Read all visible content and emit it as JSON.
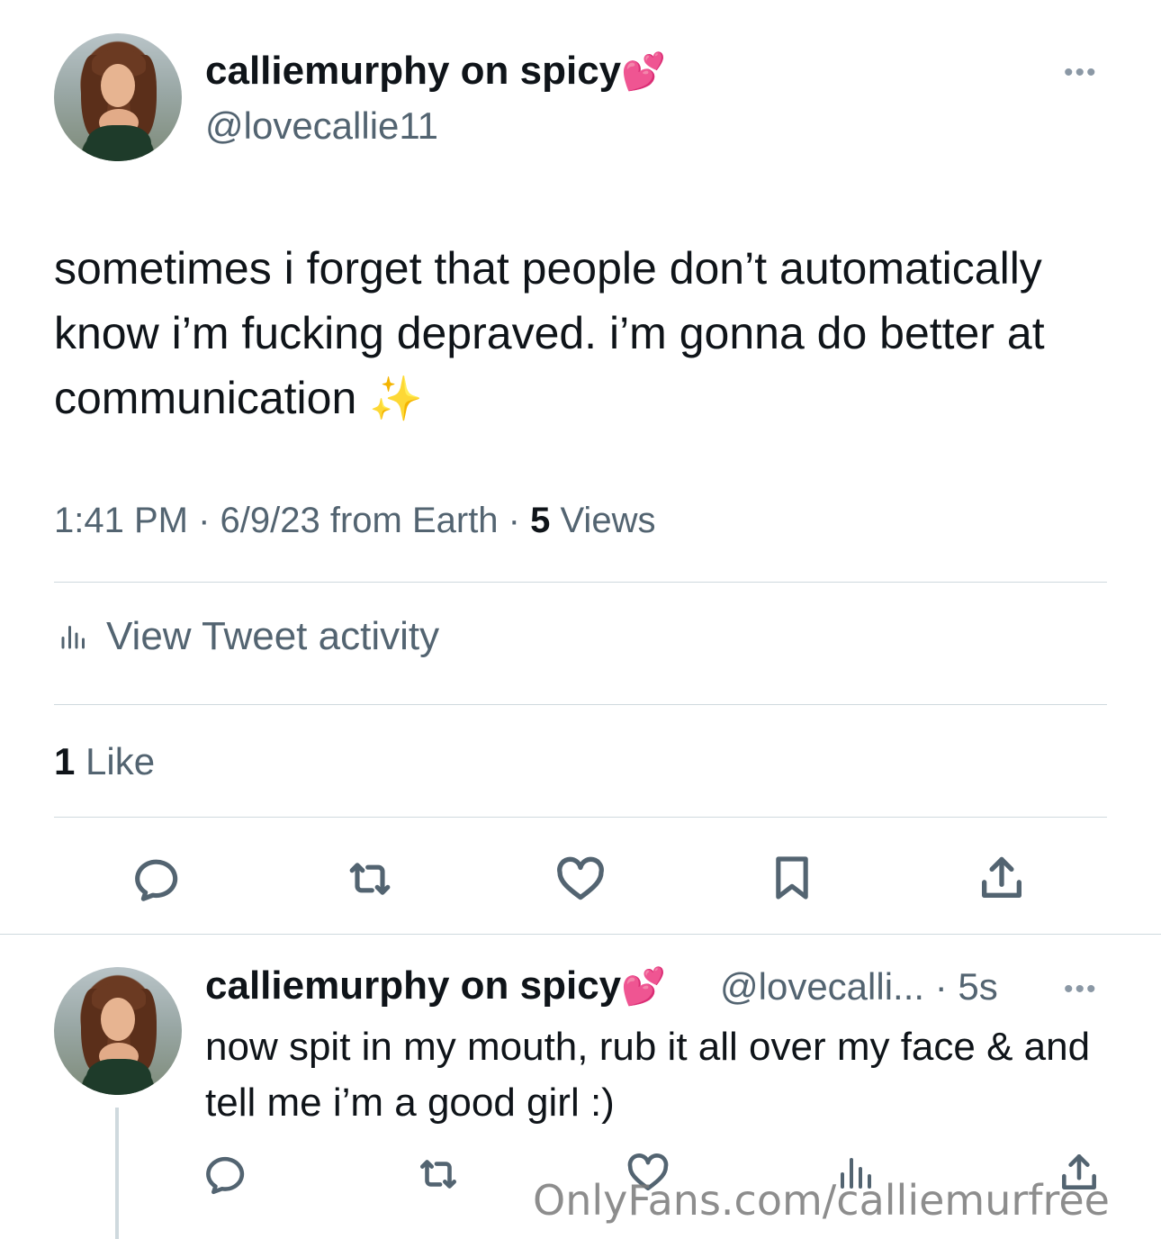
{
  "tweet": {
    "display_name": "calliemurphy on spicy",
    "name_emoji": "💕",
    "handle": "@lovecallie11",
    "more_label": "•••",
    "text": "sometimes i forget that people don’t automatically know i’m fucking depraved. i’m gonna do better at communication",
    "text_emoji": "✨",
    "time": "1:41 PM · 6/9/23 from Earth · ",
    "views_count": "5",
    "views_label": " Views",
    "activity_label": "View Tweet activity",
    "likes_count": "1",
    "likes_label": " Like"
  },
  "reply": {
    "display_name": "calliemurphy on spicy",
    "name_emoji": "💕",
    "handle_time": "@lovecalli... · 5s",
    "more_label": "•••",
    "text": "now spit in my mouth, rub it all over my face & and tell me i’m a good girl :)"
  },
  "watermark": "OnlyFans.com/calliemurfree"
}
